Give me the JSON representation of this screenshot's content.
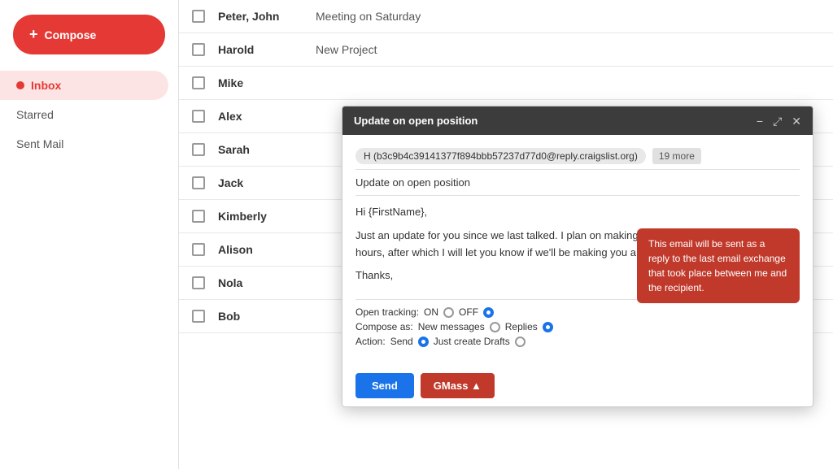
{
  "sidebar": {
    "compose_label": "Compose",
    "items": [
      {
        "id": "inbox",
        "label": "Inbox",
        "active": true
      },
      {
        "id": "starred",
        "label": "Starred",
        "active": false
      },
      {
        "id": "sent",
        "label": "Sent Mail",
        "active": false
      }
    ]
  },
  "email_list": {
    "rows": [
      {
        "sender": "Peter, John",
        "subject": "Meeting on Saturday"
      },
      {
        "sender": "Harold",
        "subject": "New Project"
      },
      {
        "sender": "Mike",
        "subject": ""
      },
      {
        "sender": "Alex",
        "subject": ""
      },
      {
        "sender": "Sarah",
        "subject": ""
      },
      {
        "sender": "Jack",
        "subject": ""
      },
      {
        "sender": "Kimberly",
        "subject": ""
      },
      {
        "sender": "Alison",
        "subject": ""
      },
      {
        "sender": "Nola",
        "subject": ""
      },
      {
        "sender": "Bob",
        "subject": ""
      }
    ]
  },
  "modal": {
    "title": "Update on open position",
    "controls": {
      "minimize": "−",
      "expand": "⤢",
      "close": "✕"
    },
    "recipient": "H (b3c9b4c39141377f894bbb57237d77d0@reply.craigslist.org)",
    "more_badge": "19 more",
    "subject": "Update on open position",
    "body_line1": "Hi {FirstName},",
    "body_line2": "Just an update for you since we last talked. I plan on making a final decision in the next 48 hours, after which I will let you know if we'll be making you a job offer or not.",
    "body_line3": "Thanks,",
    "tooltip": "This email will be sent as a reply to the last email exchange that took place between me and the recipient.",
    "options": {
      "open_tracking_label": "Open tracking:",
      "open_tracking_on": "ON",
      "open_tracking_off": "OFF",
      "compose_as_label": "Compose as:",
      "compose_as_new": "New messages",
      "compose_as_replies": "Replies",
      "action_label": "Action:",
      "action_send": "Send",
      "action_draft": "Just create Drafts"
    },
    "footer": {
      "send_label": "Send",
      "gmass_label": "GMass ▲"
    }
  }
}
